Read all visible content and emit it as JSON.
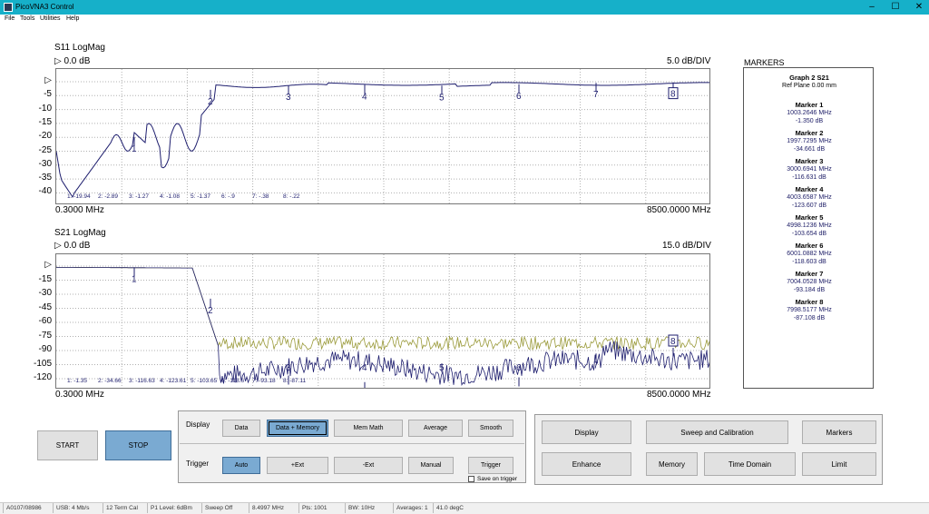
{
  "window": {
    "title": "PicoVNA3 Control",
    "controls": [
      "–",
      "☐",
      "✕"
    ]
  },
  "menu": [
    "File",
    "Tools",
    "Utilities",
    "Help"
  ],
  "plot1": {
    "title": "S11 LogMag",
    "ref": "▷  0.0 dB",
    "scale": "5.0 dB/DIV",
    "start": "0.3000 MHz",
    "stop": "8500.0000 MHz",
    "yticks": [
      "▷",
      "-5",
      "-10",
      "-15",
      "-20",
      "-25",
      "-30",
      "-35",
      "-40"
    ],
    "marker_readout": [
      "1: -19.94",
      "2: -2.89",
      "3: -1.27",
      "4: -1.08",
      "5: -1.37",
      "6: -.9",
      "7: -.38",
      "8: -.22"
    ],
    "marker_labels": [
      "1",
      "2",
      "3",
      "4",
      "5",
      "6",
      "7",
      "8"
    ]
  },
  "plot2": {
    "title": "S21 LogMag",
    "ref": "▷  0.0 dB",
    "scale": "15.0 dB/DIV",
    "start": "0.3000 MHz",
    "stop": "8500.0000 MHz",
    "yticks": [
      "▷",
      "-15",
      "-30",
      "-45",
      "-60",
      "-75",
      "-90",
      "-105",
      "-120"
    ],
    "marker_readout": [
      "1: -1.35",
      "2: -34.66",
      "3: -116.63",
      "4: -123.61",
      "5: -103.65",
      "6: -118.6",
      "7: -93.18",
      "8: -87.11"
    ],
    "marker_labels": [
      "1",
      "2",
      "3",
      "4",
      "5",
      "6",
      "7",
      "8"
    ]
  },
  "markers_panel": {
    "heading": "MARKERS",
    "graph": "Graph 2 S21",
    "ref_plane": "Ref Plane 0.00 mm",
    "markers": [
      {
        "title": "Marker  1",
        "freq": "1003.2646 MHz",
        "value": "-1.350 dB"
      },
      {
        "title": "Marker  2",
        "freq": "1997.7295 MHz",
        "value": "-34.661 dB"
      },
      {
        "title": "Marker  3",
        "freq": "3000.6941 MHz",
        "value": "-116.631 dB"
      },
      {
        "title": "Marker  4",
        "freq": "4003.6587 MHz",
        "value": "-123.607 dB"
      },
      {
        "title": "Marker  5",
        "freq": "4998.1236 MHz",
        "value": "-103.654 dB"
      },
      {
        "title": "Marker  6",
        "freq": "6001.0882 MHz",
        "value": "-118.603 dB"
      },
      {
        "title": "Marker  7",
        "freq": "7004.0528 MHz",
        "value": "-93.184 dB"
      },
      {
        "title": "Marker  8",
        "freq": "7998.5177 MHz",
        "value": "-87.108 dB"
      }
    ]
  },
  "controls": {
    "start": "START",
    "stop": "STOP",
    "display_label": "Display",
    "display_buttons": [
      "Data",
      "Data + Memory",
      "Mem Math",
      "Average",
      "Smooth"
    ],
    "trigger_label": "Trigger",
    "trigger_buttons": [
      "Auto",
      "+Ext",
      "-Ext",
      "Manual",
      "Trigger"
    ],
    "save_on_trigger": "Save  on trigger",
    "menu_buttons": [
      "Display",
      "Sweep and Calibration",
      "Markers",
      "Enhance",
      "Memory",
      "Time Domain",
      "Limit"
    ]
  },
  "status": [
    "A0107/08986",
    "USB: 4 Mb/s",
    "12 Term Cal",
    "P1 Level: 6dBm",
    "Sweep Off",
    "8.4997 MHz",
    "Pts: 1001",
    "BW: 10Hz",
    "Averages: 1",
    "41.0 degC"
  ],
  "colors": {
    "trace_data": "#1e1e6e",
    "trace_memory": "#9a9a3a",
    "selected": "#7aaad2",
    "titlebar": "#16b0c9"
  }
}
